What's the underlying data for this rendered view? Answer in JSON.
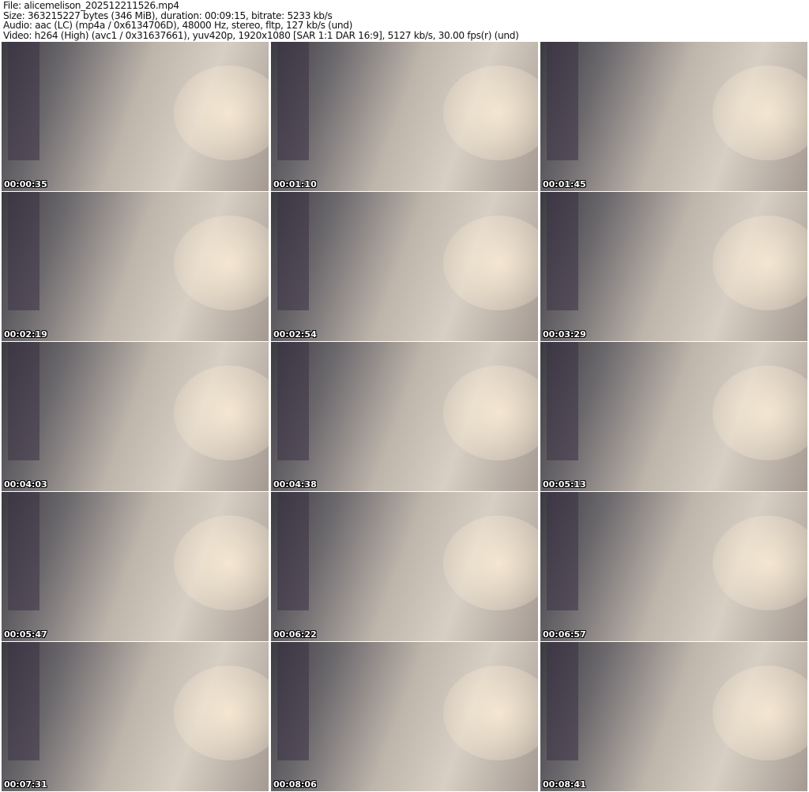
{
  "header": {
    "file": "File: alicemelison_202512211526.mp4",
    "size": "Size: 363215227 bytes (346 MiB), duration: 00:09:15, bitrate: 5233 kb/s",
    "audio": "Audio: aac (LC) (mp4a / 0x6134706D), 48000 Hz, stereo, fltp, 127 kb/s (und)",
    "video": "Video: h264 (High) (avc1 / 0x31637661), yuv420p, 1920x1080 [SAR 1:1 DAR 16:9], 5127 kb/s, 30.00 fps(r) (und)"
  },
  "thumbnails": [
    {
      "timestamp": "00:00:35"
    },
    {
      "timestamp": "00:01:10"
    },
    {
      "timestamp": "00:01:45"
    },
    {
      "timestamp": "00:02:19"
    },
    {
      "timestamp": "00:02:54"
    },
    {
      "timestamp": "00:03:29"
    },
    {
      "timestamp": "00:04:03"
    },
    {
      "timestamp": "00:04:38"
    },
    {
      "timestamp": "00:05:13"
    },
    {
      "timestamp": "00:05:47"
    },
    {
      "timestamp": "00:06:22"
    },
    {
      "timestamp": "00:06:57"
    },
    {
      "timestamp": "00:07:31"
    },
    {
      "timestamp": "00:08:06"
    },
    {
      "timestamp": "00:08:41"
    }
  ]
}
